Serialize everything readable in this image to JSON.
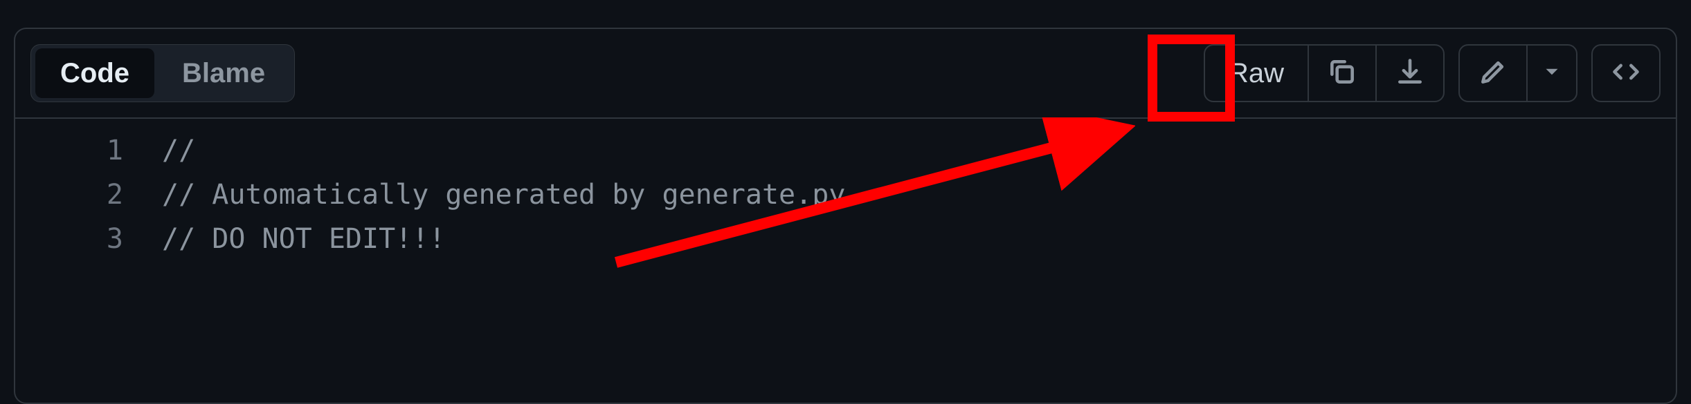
{
  "toolbar": {
    "tabs": {
      "code": "Code",
      "blame": "Blame"
    },
    "raw_label": "Raw"
  },
  "code": {
    "lines": [
      {
        "num": "1",
        "text": "//"
      },
      {
        "num": "2",
        "text": "// Automatically generated by generate.py."
      },
      {
        "num": "3",
        "text": "// DO NOT EDIT!!!"
      }
    ]
  },
  "annotation": {
    "highlight_color": "#ff0000"
  }
}
